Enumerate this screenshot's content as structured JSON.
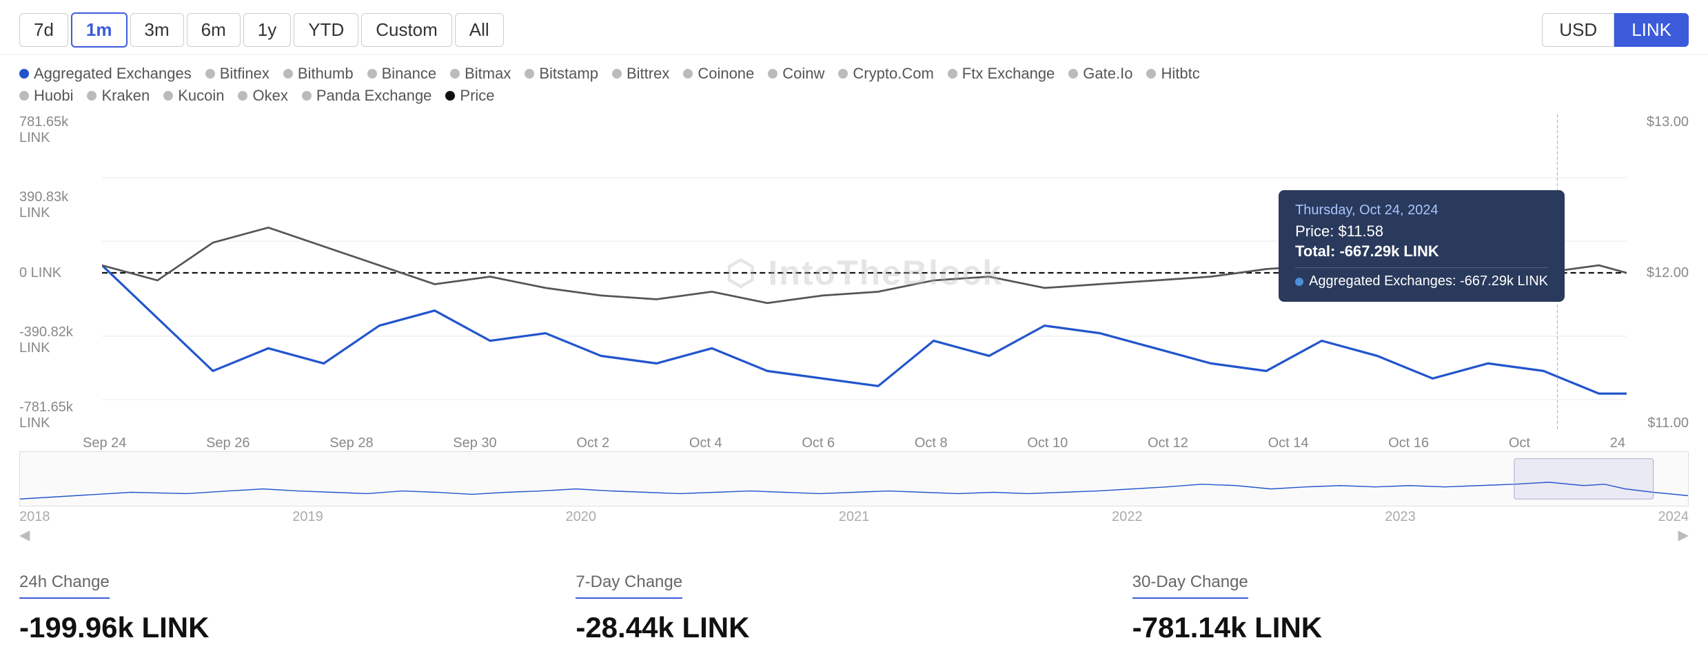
{
  "timeButtons": [
    {
      "label": "7d",
      "active": false
    },
    {
      "label": "1m",
      "active": true
    },
    {
      "label": "3m",
      "active": false
    },
    {
      "label": "6m",
      "active": false
    },
    {
      "label": "1y",
      "active": false
    },
    {
      "label": "YTD",
      "active": false
    },
    {
      "label": "Custom",
      "active": false
    },
    {
      "label": "All",
      "active": false
    }
  ],
  "currencyButtons": [
    {
      "label": "USD",
      "active": false
    },
    {
      "label": "LINK",
      "active": true
    }
  ],
  "legend": [
    {
      "label": "Aggregated Exchanges",
      "color": "#2255cc",
      "filled": true
    },
    {
      "label": "Bitfinex",
      "color": "#aaa",
      "filled": false
    },
    {
      "label": "Bithumb",
      "color": "#aaa",
      "filled": false
    },
    {
      "label": "Binance",
      "color": "#aaa",
      "filled": false
    },
    {
      "label": "Bitmax",
      "color": "#aaa",
      "filled": false
    },
    {
      "label": "Bitstamp",
      "color": "#aaa",
      "filled": false
    },
    {
      "label": "Bittrex",
      "color": "#aaa",
      "filled": false
    },
    {
      "label": "Coinone",
      "color": "#aaa",
      "filled": false
    },
    {
      "label": "Coinw",
      "color": "#aaa",
      "filled": false
    },
    {
      "label": "Crypto.Com",
      "color": "#aaa",
      "filled": false
    },
    {
      "label": "Ftx Exchange",
      "color": "#aaa",
      "filled": false
    },
    {
      "label": "Gate.Io",
      "color": "#aaa",
      "filled": false
    },
    {
      "label": "Hitbtc",
      "color": "#aaa",
      "filled": false
    },
    {
      "label": "Huobi",
      "color": "#aaa",
      "filled": false
    },
    {
      "label": "Kraken",
      "color": "#aaa",
      "filled": false
    },
    {
      "label": "Kucoin",
      "color": "#aaa",
      "filled": false
    },
    {
      "label": "Okex",
      "color": "#aaa",
      "filled": false
    },
    {
      "label": "Panda Exchange",
      "color": "#aaa",
      "filled": false
    },
    {
      "label": "Price",
      "color": "#111",
      "filled": true
    }
  ],
  "yLabelsLeft": [
    "781.65k LINK",
    "390.83k LINK",
    "0 LINK",
    "-390.82k LINK",
    "-781.65k LINK"
  ],
  "yLabelsRight": [
    "$13.00",
    "$12.00",
    "$11.00"
  ],
  "xLabels": [
    "Sep 24",
    "Sep 26",
    "Sep 28",
    "Sep 30",
    "Oct 2",
    "Oct 4",
    "Oct 6",
    "Oct 8",
    "Oct 10",
    "Oct 12",
    "Oct 14",
    "Oct 16",
    "Oct",
    "24"
  ],
  "miniXLabels": [
    "2018",
    "2019",
    "2020",
    "2021",
    "2022",
    "2023",
    "2024"
  ],
  "tooltip": {
    "date": "Thursday, Oct 24, 2024",
    "price_label": "Price:",
    "price_value": "$11.58",
    "total_label": "Total:",
    "total_value": "-667.29k LINK",
    "agg_label": "Aggregated Exchanges: -667.29k LINK"
  },
  "watermark": "⬡ IntoTheBlock",
  "stats": [
    {
      "label": "24h Change",
      "value": "-199.96k LINK"
    },
    {
      "label": "7-Day Change",
      "value": "-28.44k LINK"
    },
    {
      "label": "30-Day Change",
      "value": "-781.14k LINK"
    }
  ]
}
